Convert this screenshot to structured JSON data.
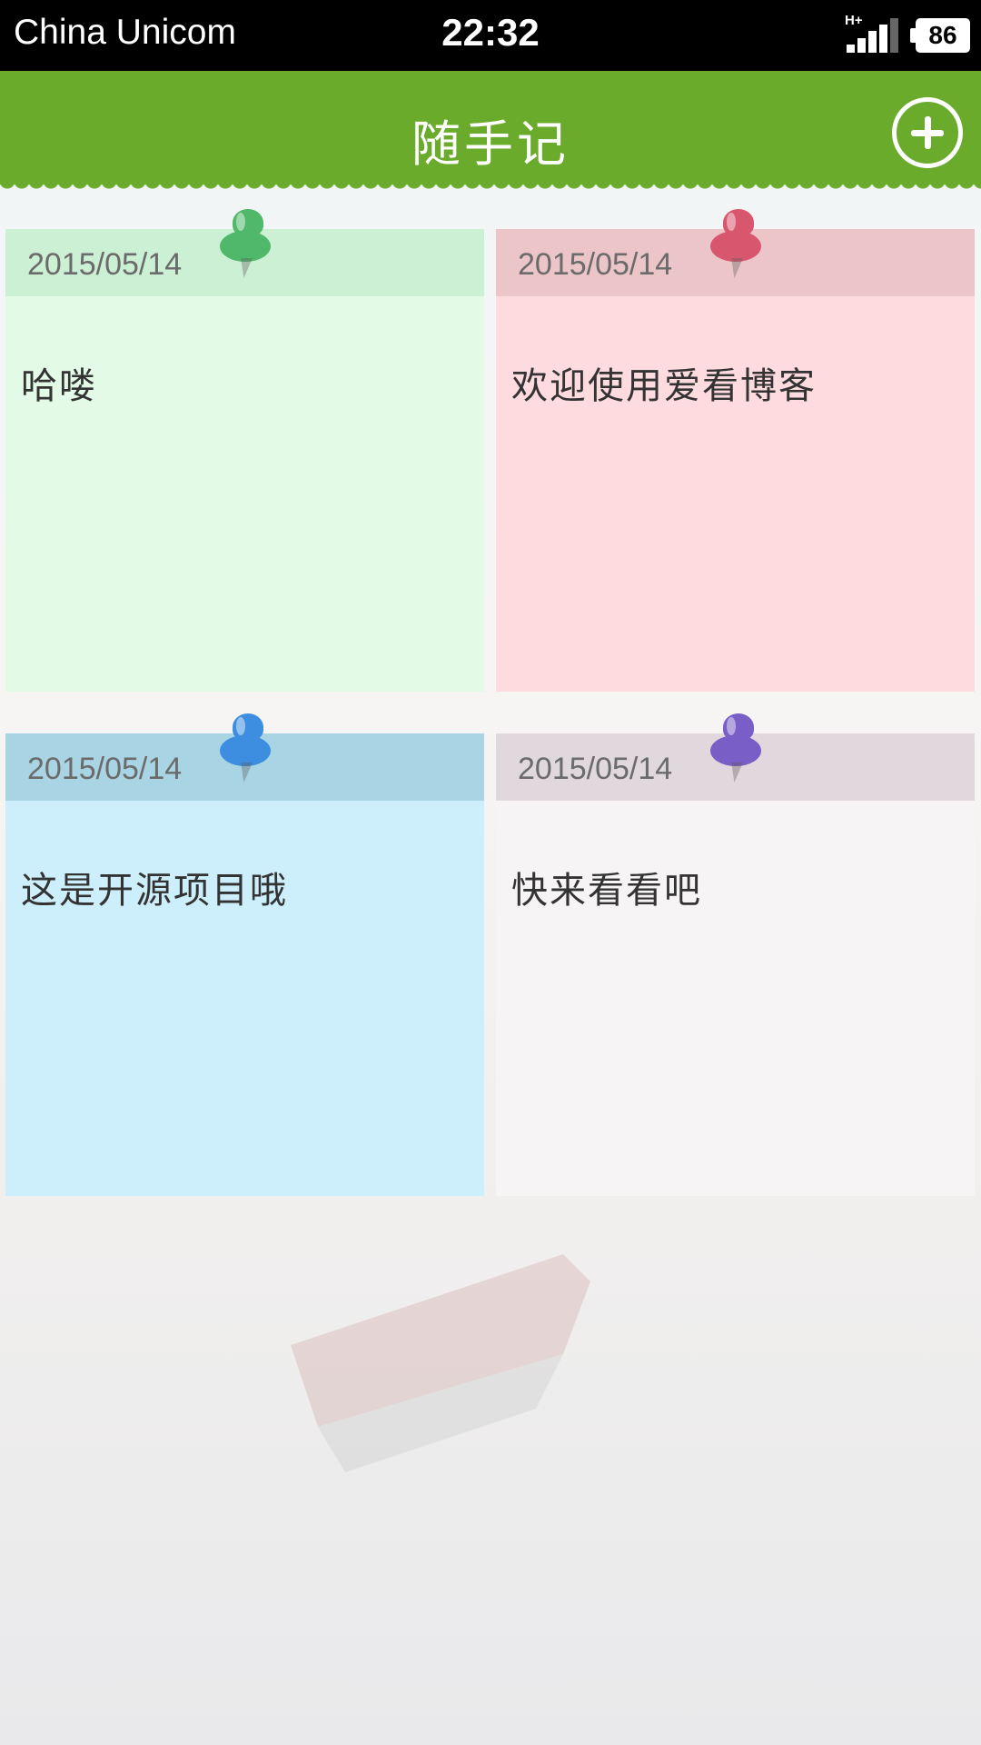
{
  "status_bar": {
    "carrier": "China Unicom",
    "time": "22:32",
    "network": "H+",
    "battery": "86"
  },
  "header": {
    "title": "随手记",
    "add_icon": "plus-circle-icon"
  },
  "notes": [
    {
      "date": "2015/05/14",
      "text": "哈喽",
      "pin_color": "#4fb86a",
      "header_color": "#ccf0d4",
      "body_color": "#e3fae6"
    },
    {
      "date": "2015/05/14",
      "text": "欢迎使用爱看博客",
      "pin_color": "#d9566f",
      "header_color": "#ecc5c8",
      "body_color": "#fedbdf"
    },
    {
      "date": "2015/05/14",
      "text": "这是开源项目哦",
      "pin_color": "#3d8ee0",
      "header_color": "#a8d4e4",
      "body_color": "#cceffb"
    },
    {
      "date": "2015/05/14",
      "text": "快来看看吧",
      "pin_color": "#7a5ec7",
      "header_color": "#e0d8dc",
      "body_color": "#f7f4f5"
    }
  ],
  "colors": {
    "title_bar": "#6aab2c"
  }
}
